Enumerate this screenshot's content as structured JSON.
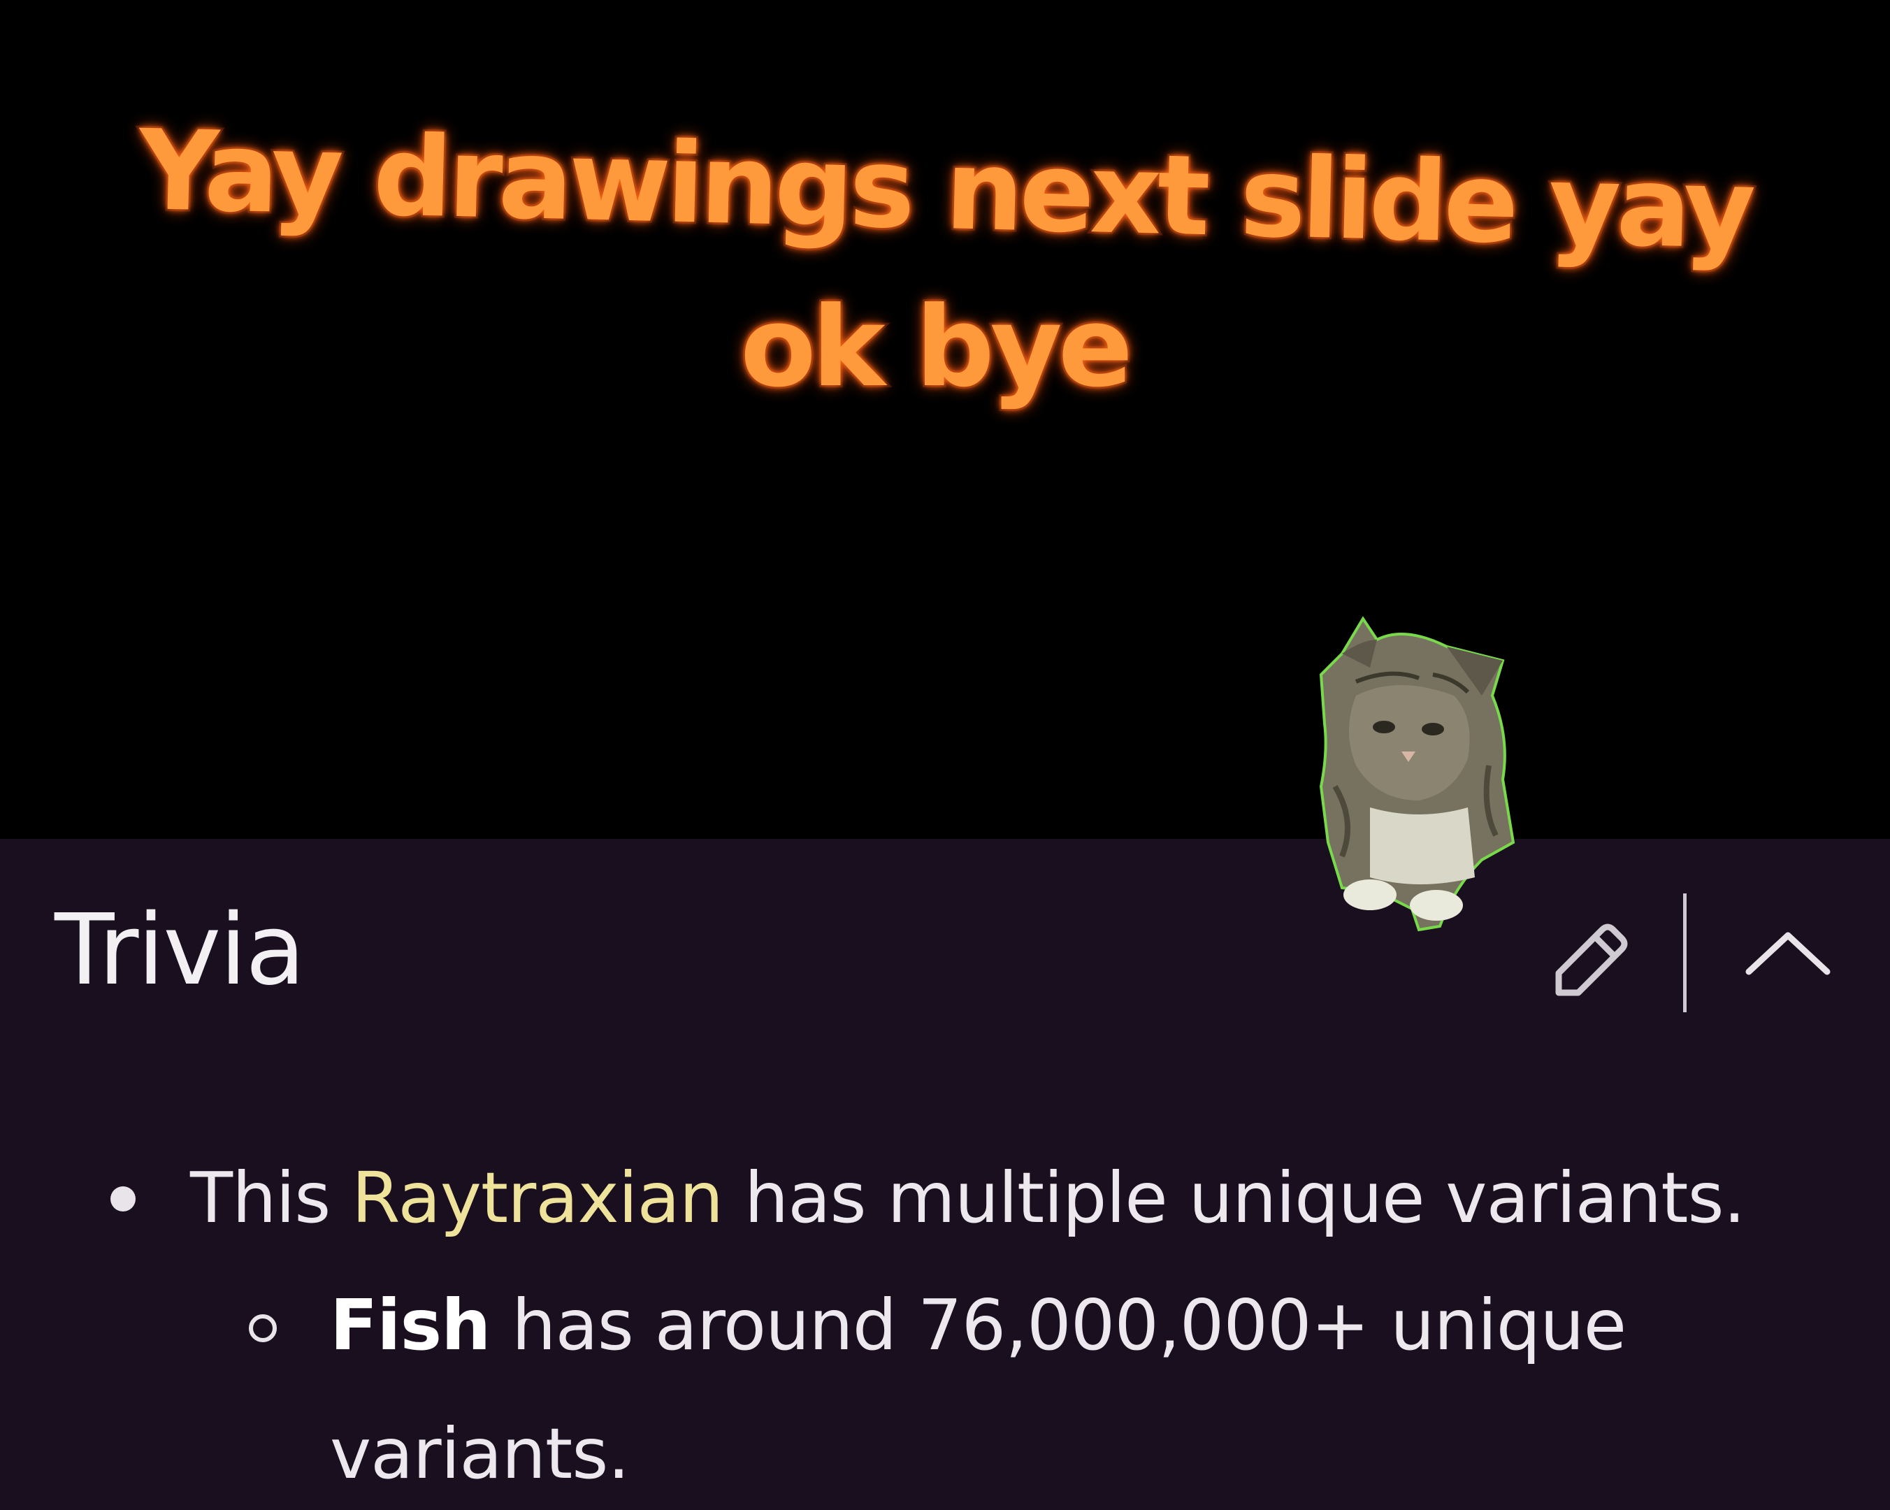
{
  "overlay_caption": {
    "line1": "Yay drawings next slide yay",
    "line2": "ok bye"
  },
  "section": {
    "title": "Trivia",
    "edit_icon": "pencil-icon",
    "collapse_icon": "chevron-up-icon"
  },
  "trivia": {
    "item1": {
      "prefix": "This ",
      "link": "Raytraxian",
      "suffix": " has multiple unique variants."
    },
    "subitem1": {
      "bold": "Fish",
      "text_line1": " has around 76,000,000+ unique",
      "text_line2": "variants."
    }
  },
  "colors": {
    "caption_fill": "#ff9a3c",
    "panel_background": "#1a0f1f",
    "link": "#efe39c",
    "text": "#ece8ee"
  },
  "sticker": "kitten-sticker"
}
